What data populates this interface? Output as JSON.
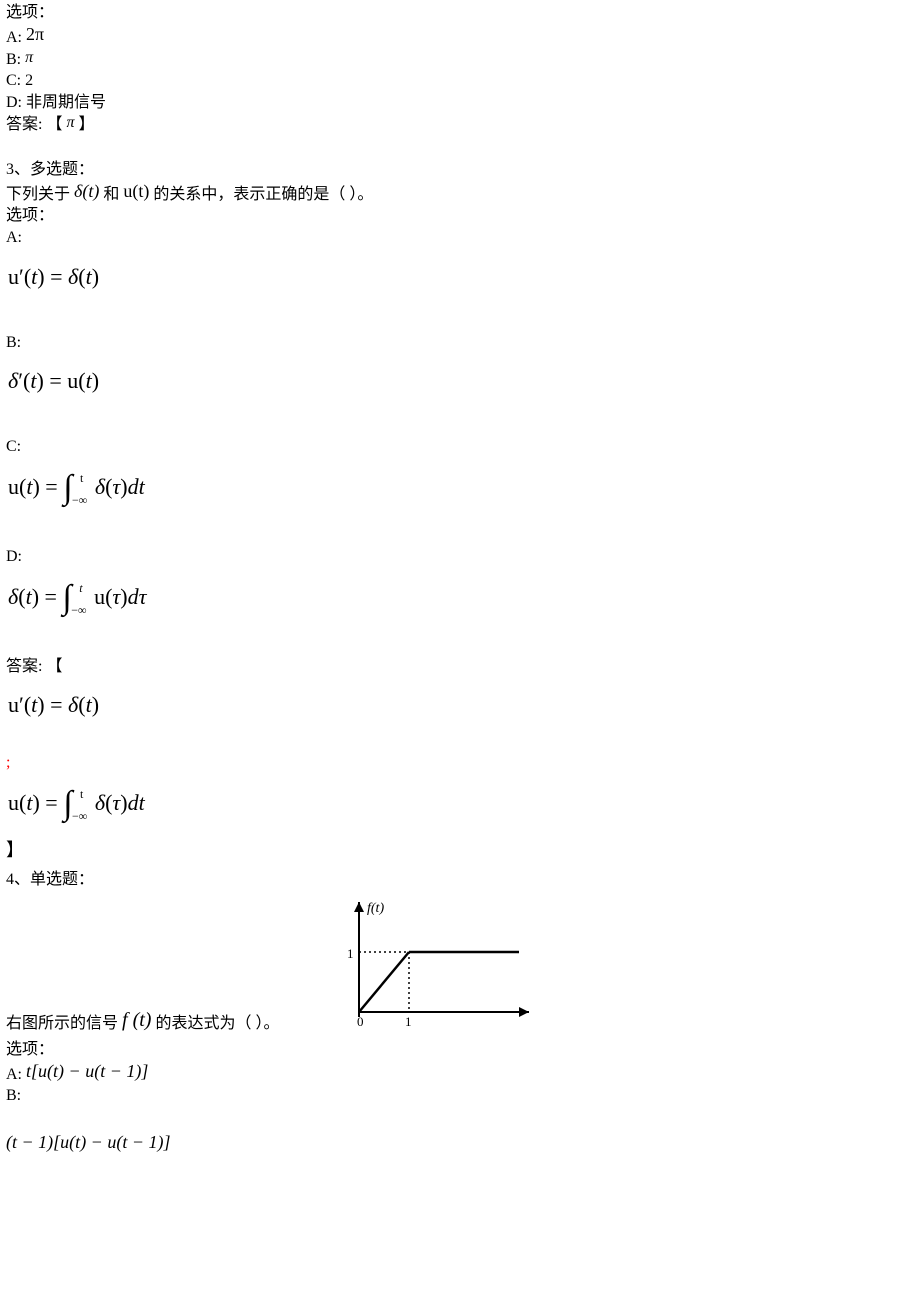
{
  "q2": {
    "options_label": "选项：",
    "A_label": "A: ",
    "A_expr": "2π",
    "B_label": "B: ",
    "B_expr": "π",
    "C_label": "C: ",
    "C_val": "2",
    "D_label": "D: ",
    "D_val": "非周期信号",
    "answer_label": "答案: 【 ",
    "answer_expr": "π",
    "answer_close": " 】"
  },
  "q3": {
    "header": "3、多选题：",
    "stem_pre": "下列关于 ",
    "stem_d": "δ(t)",
    "stem_mid": " 和 ",
    "stem_u": "u(t)",
    "stem_post": " 的关系中，表示正确的是（  ）。",
    "options_label": "选项：",
    "A": "A:",
    "A_eq": "u′(t) = δ(t)",
    "B": "B:",
    "B_eq": "δ′(t) = u(t)",
    "C": "C:",
    "C_left": "u(t) = ",
    "C_upper": "t",
    "C_lower": "−∞",
    "C_right": " δ(τ)dt",
    "D": "D:",
    "D_left": "δ(t) = ",
    "D_upper": "t",
    "D_lower": "−∞",
    "D_right": " u(τ)dτ",
    "answer_open": "答案: 【",
    "ans1": "u′(t) = δ(t)",
    "sep": ";",
    "ans2_left": "u(t) = ",
    "ans2_upper": "t",
    "ans2_lower": "−∞",
    "ans2_right": " δ(τ)dt",
    "answer_close": "】"
  },
  "q4": {
    "header": "4、单选题：",
    "stem_pre": "右图所示的信号 ",
    "stem_f": "f (t)",
    "stem_post": " 的表达式为（  ）。",
    "options_label": "选项：",
    "A_label": "A: ",
    "A_eq": "t[u(t) − u(t − 1)]",
    "B_label": "B:",
    "B_eq": "(t − 1)[u(t) − u(t − 1)]"
  },
  "chart_data": {
    "type": "line",
    "title": "",
    "xlabel": "",
    "ylabel": "f(t)",
    "xlim": [
      0,
      3
    ],
    "ylim": [
      0,
      1.4
    ],
    "series": [
      {
        "name": "f(t)",
        "x": [
          0,
          1,
          3
        ],
        "y": [
          0,
          1,
          1
        ]
      }
    ],
    "ticks_x": [
      "0",
      "1"
    ],
    "ticks_y": [
      "1"
    ],
    "guides": [
      {
        "kind": "h-dotted",
        "y": 1,
        "x0": 0,
        "x1": 1
      },
      {
        "kind": "v-dotted",
        "x": 1,
        "y0": 0,
        "y1": 1
      }
    ]
  }
}
